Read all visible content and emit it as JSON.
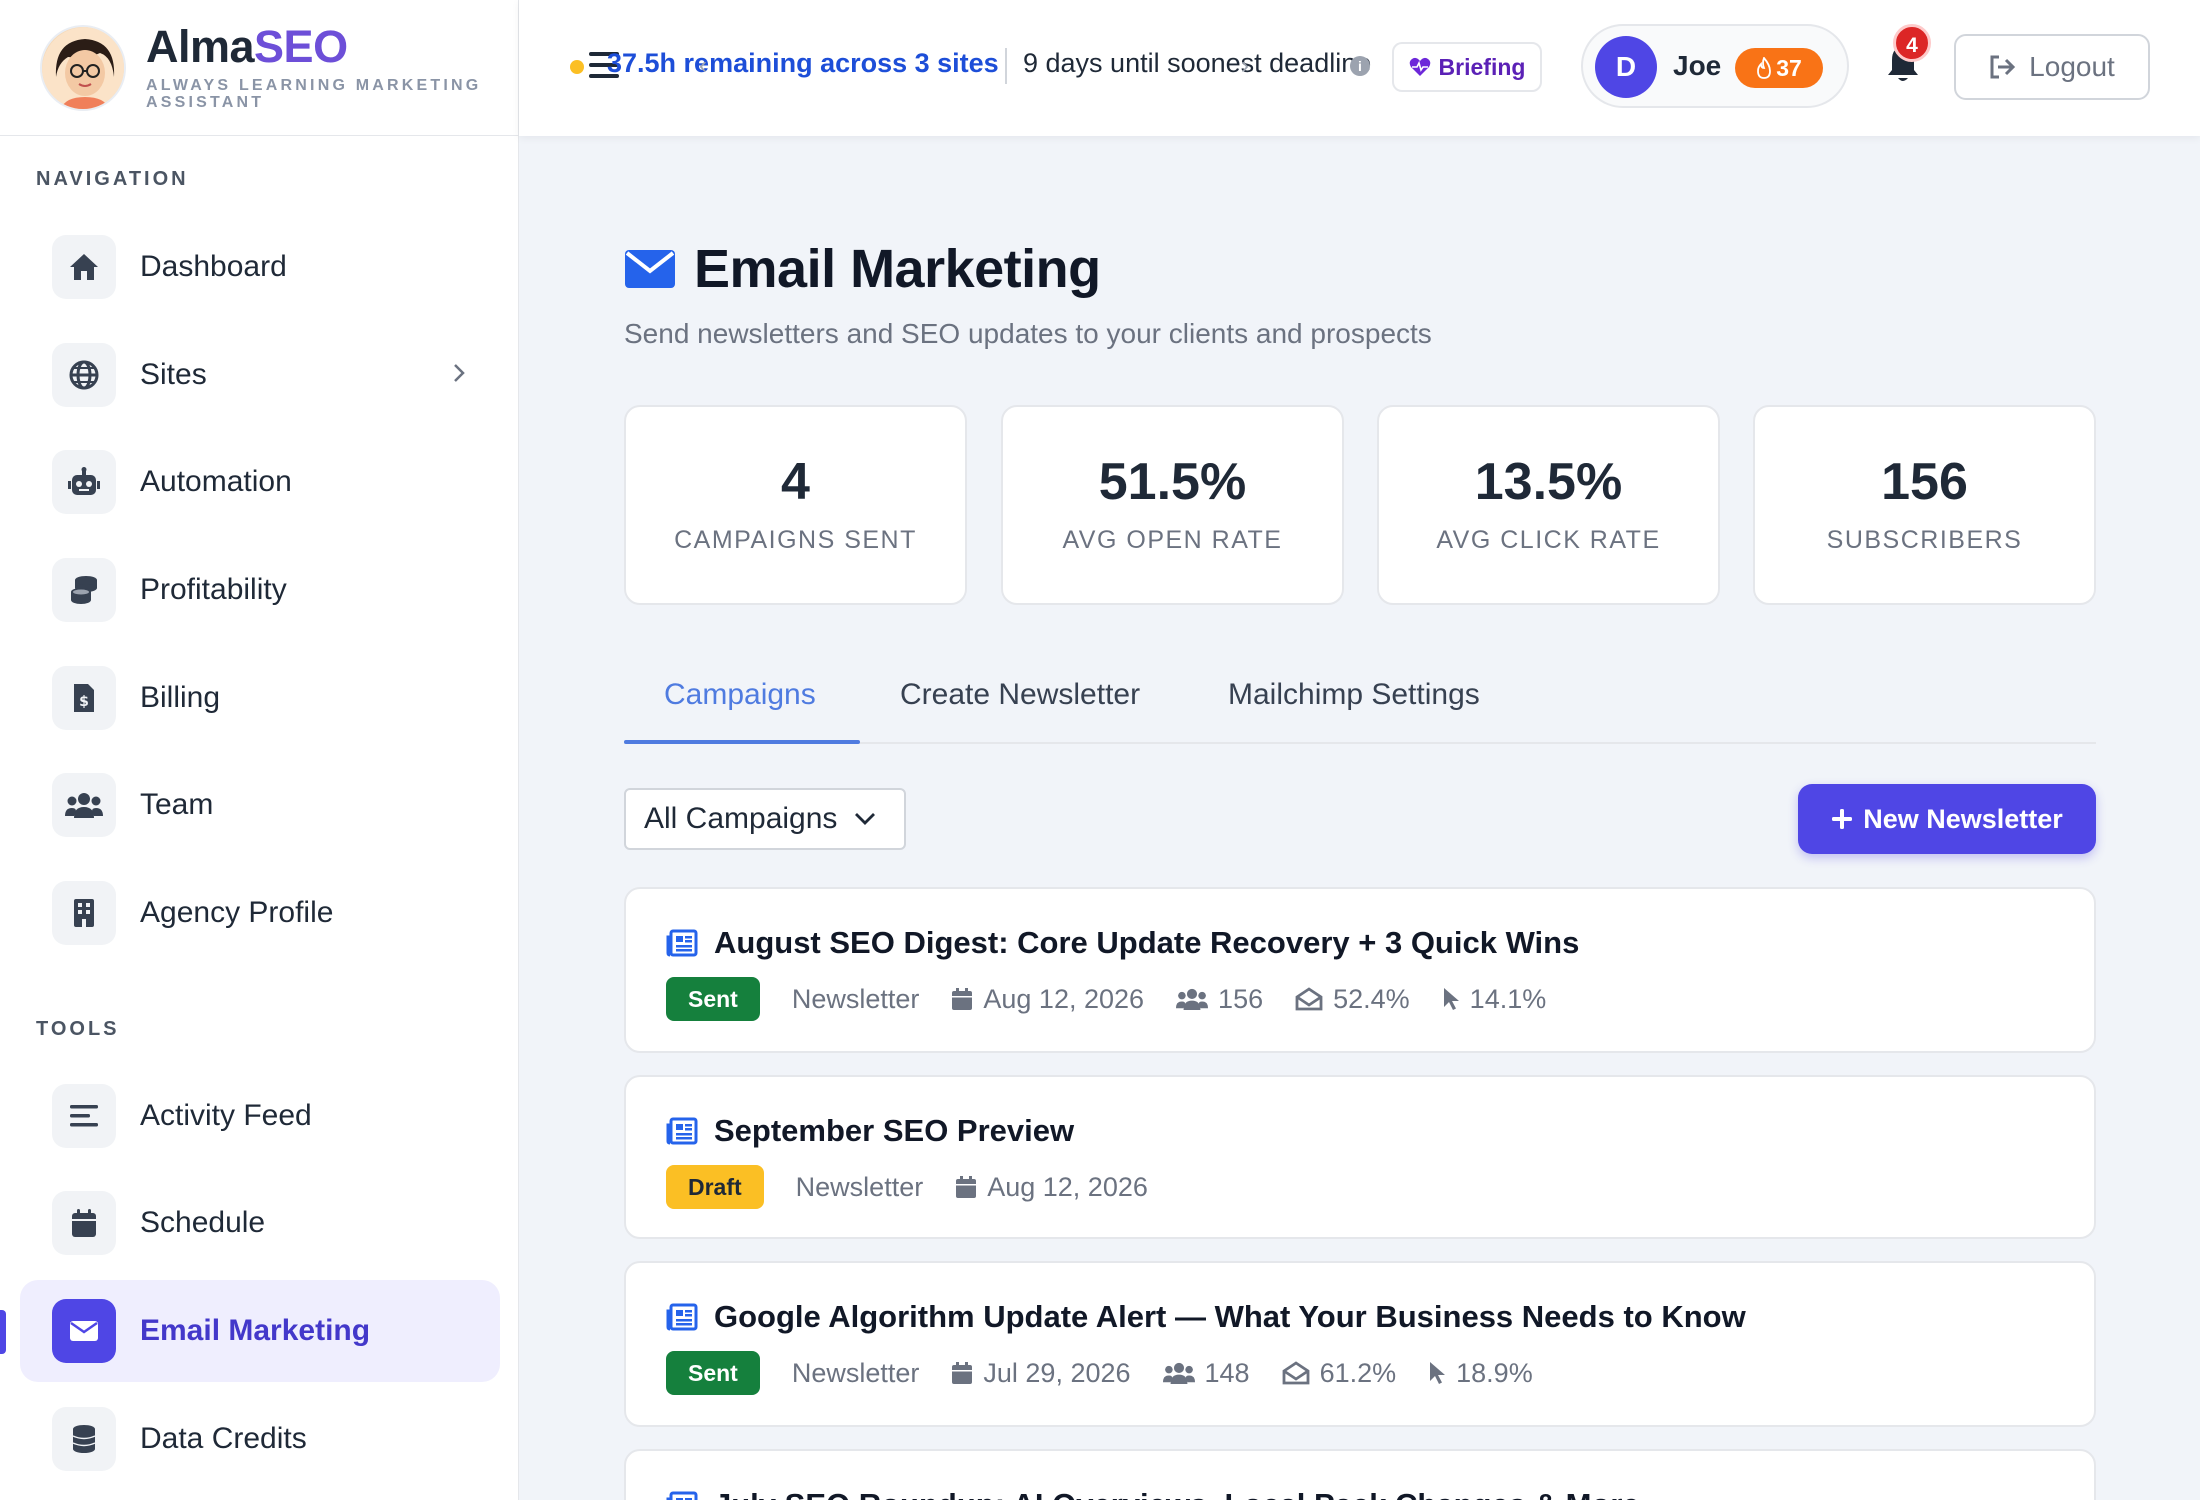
{
  "brand": {
    "name_prefix": "Alma",
    "name_suffix": "SEO",
    "tagline": "ALWAYS LEARNING MARKETING ASSISTANT"
  },
  "nav": {
    "section_label": "NAVIGATION",
    "items": [
      {
        "label": "Dashboard",
        "icon": "home-icon"
      },
      {
        "label": "Sites",
        "icon": "globe-icon"
      },
      {
        "label": "Automation",
        "icon": "robot-icon"
      },
      {
        "label": "Profitability",
        "icon": "coins-icon"
      },
      {
        "label": "Billing",
        "icon": "invoice-icon"
      },
      {
        "label": "Team",
        "icon": "users-icon"
      },
      {
        "label": "Agency Profile",
        "icon": "building-icon"
      }
    ]
  },
  "tools": {
    "section_label": "TOOLS",
    "items": [
      {
        "label": "Activity Feed",
        "icon": "list-icon"
      },
      {
        "label": "Schedule",
        "icon": "calendar-icon"
      },
      {
        "label": "Email Marketing",
        "icon": "envelope-icon",
        "active": true
      },
      {
        "label": "Data Credits",
        "icon": "database-icon"
      }
    ]
  },
  "topbar": {
    "remaining": "37.5h remaining across 3 sites",
    "deadline": "9 days until soonest deadline",
    "briefing": "Briefing",
    "user_initial": "D",
    "user_name": "Joe",
    "streak": "37",
    "notifications": "4",
    "logout": "Logout"
  },
  "page": {
    "title": "Email Marketing",
    "subtitle": "Send newsletters and SEO updates to your clients and prospects"
  },
  "stats": [
    {
      "value": "4",
      "label": "CAMPAIGNS SENT"
    },
    {
      "value": "51.5%",
      "label": "AVG OPEN RATE"
    },
    {
      "value": "13.5%",
      "label": "AVG CLICK RATE"
    },
    {
      "value": "156",
      "label": "SUBSCRIBERS"
    }
  ],
  "tabs": [
    "Campaigns",
    "Create Newsletter",
    "Mailchimp Settings"
  ],
  "filter": {
    "selected": "All Campaigns"
  },
  "new_button": "New Newsletter",
  "campaigns": [
    {
      "title": "August SEO Digest: Core Update Recovery + 3 Quick Wins",
      "status": "Sent",
      "type": "Newsletter",
      "date": "Aug 12, 2026",
      "recipients": "156",
      "open_rate": "52.4%",
      "click_rate": "14.1%"
    },
    {
      "title": "September SEO Preview",
      "status": "Draft",
      "type": "Newsletter",
      "date": "Aug 12, 2026"
    },
    {
      "title": "Google Algorithm Update Alert — What Your Business Needs to Know",
      "status": "Sent",
      "type": "Newsletter",
      "date": "Jul 29, 2026",
      "recipients": "148",
      "open_rate": "61.2%",
      "click_rate": "18.9%"
    },
    {
      "title": "July SEO Roundup: AI Overviews, Local Pack Changes & More"
    }
  ],
  "colors": {
    "accent": "#4f46e5",
    "brand_purple": "#6d4fd8",
    "sent": "#15803d",
    "draft": "#fbbf24",
    "link_blue": "#1d4ed8"
  }
}
